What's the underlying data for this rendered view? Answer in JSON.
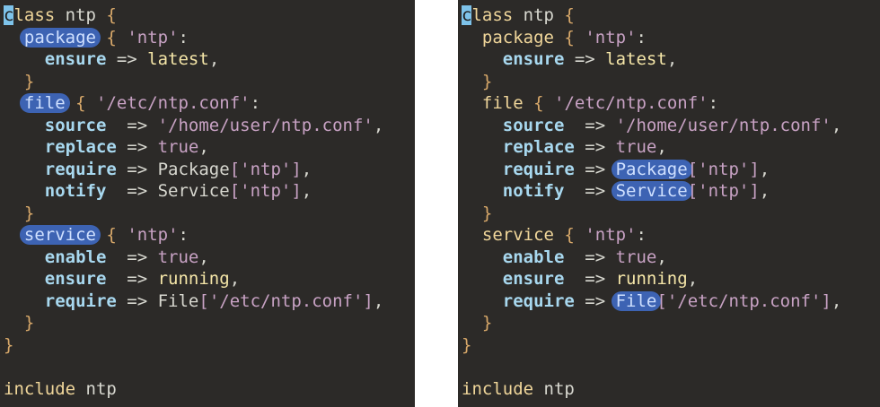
{
  "panes": [
    {
      "id": "left",
      "highlighted": [
        "package",
        "file",
        "service"
      ],
      "lines": [
        {
          "indent": "",
          "parts": [
            {
              "t": "c",
              "c": "kw cursor"
            },
            {
              "t": "lass ",
              "c": "kw"
            },
            {
              "t": "ntp ",
              "c": "plain"
            },
            {
              "t": "{",
              "c": "brace"
            }
          ]
        },
        {
          "indent": "  ",
          "parts": [
            {
              "t": "package",
              "c": "kw hl"
            },
            {
              "t": " ",
              "c": "plain"
            },
            {
              "t": "{",
              "c": "brace"
            },
            {
              "t": " 'ntp'",
              "c": "str"
            },
            {
              "t": ":",
              "c": "plain"
            }
          ]
        },
        {
          "indent": "    ",
          "parts": [
            {
              "t": "ensure",
              "c": "attr"
            },
            {
              "t": " => ",
              "c": "op"
            },
            {
              "t": "latest",
              "c": "val"
            },
            {
              "t": ",",
              "c": "plain"
            }
          ]
        },
        {
          "indent": "  ",
          "parts": [
            {
              "t": "}",
              "c": "brace"
            }
          ]
        },
        {
          "indent": "  ",
          "parts": [
            {
              "t": "file",
              "c": "kw hl"
            },
            {
              "t": " ",
              "c": "plain"
            },
            {
              "t": "{",
              "c": "brace"
            },
            {
              "t": " '/etc/ntp.conf'",
              "c": "str"
            },
            {
              "t": ":",
              "c": "plain"
            }
          ]
        },
        {
          "indent": "    ",
          "parts": [
            {
              "t": "source",
              "c": "attr"
            },
            {
              "t": "  => ",
              "c": "op"
            },
            {
              "t": "'/home/user/ntp.conf'",
              "c": "str"
            },
            {
              "t": ",",
              "c": "plain"
            }
          ]
        },
        {
          "indent": "    ",
          "parts": [
            {
              "t": "replace",
              "c": "attr"
            },
            {
              "t": " => ",
              "c": "op"
            },
            {
              "t": "true",
              "c": "str"
            },
            {
              "t": ",",
              "c": "plain"
            }
          ]
        },
        {
          "indent": "    ",
          "parts": [
            {
              "t": "require",
              "c": "attr"
            },
            {
              "t": " => ",
              "c": "op"
            },
            {
              "t": "Package",
              "c": "ref"
            },
            {
              "t": "['ntp']",
              "c": "str"
            },
            {
              "t": ",",
              "c": "plain"
            }
          ]
        },
        {
          "indent": "    ",
          "parts": [
            {
              "t": "notify",
              "c": "attr"
            },
            {
              "t": "  => ",
              "c": "op"
            },
            {
              "t": "Service",
              "c": "ref"
            },
            {
              "t": "['ntp']",
              "c": "str"
            },
            {
              "t": ",",
              "c": "plain"
            }
          ]
        },
        {
          "indent": "  ",
          "parts": [
            {
              "t": "}",
              "c": "brace"
            }
          ]
        },
        {
          "indent": "  ",
          "parts": [
            {
              "t": "service",
              "c": "kw hl"
            },
            {
              "t": " ",
              "c": "plain"
            },
            {
              "t": "{",
              "c": "brace"
            },
            {
              "t": " 'ntp'",
              "c": "str"
            },
            {
              "t": ":",
              "c": "plain"
            }
          ]
        },
        {
          "indent": "    ",
          "parts": [
            {
              "t": "enable",
              "c": "attr"
            },
            {
              "t": "  => ",
              "c": "op"
            },
            {
              "t": "true",
              "c": "str"
            },
            {
              "t": ",",
              "c": "plain"
            }
          ]
        },
        {
          "indent": "    ",
          "parts": [
            {
              "t": "ensure",
              "c": "attr"
            },
            {
              "t": "  => ",
              "c": "op"
            },
            {
              "t": "running",
              "c": "val"
            },
            {
              "t": ",",
              "c": "plain"
            }
          ]
        },
        {
          "indent": "    ",
          "parts": [
            {
              "t": "require",
              "c": "attr"
            },
            {
              "t": " => ",
              "c": "op"
            },
            {
              "t": "File",
              "c": "ref"
            },
            {
              "t": "['/etc/ntp.conf']",
              "c": "str"
            },
            {
              "t": ",",
              "c": "plain"
            }
          ]
        },
        {
          "indent": "  ",
          "parts": [
            {
              "t": "}",
              "c": "brace"
            }
          ]
        },
        {
          "indent": "",
          "parts": [
            {
              "t": "}",
              "c": "brace"
            }
          ]
        },
        {
          "indent": "",
          "parts": []
        },
        {
          "indent": "",
          "parts": [
            {
              "t": "include",
              "c": "kw"
            },
            {
              "t": " ntp",
              "c": "plain"
            }
          ]
        }
      ]
    },
    {
      "id": "right",
      "highlighted": [
        "Package",
        "Service",
        "File"
      ],
      "lines": [
        {
          "indent": "",
          "parts": [
            {
              "t": "c",
              "c": "kw cursor"
            },
            {
              "t": "lass ",
              "c": "kw"
            },
            {
              "t": "ntp ",
              "c": "plain"
            },
            {
              "t": "{",
              "c": "brace"
            }
          ]
        },
        {
          "indent": "  ",
          "parts": [
            {
              "t": "package",
              "c": "kw"
            },
            {
              "t": " ",
              "c": "plain"
            },
            {
              "t": "{",
              "c": "brace"
            },
            {
              "t": " 'ntp'",
              "c": "str"
            },
            {
              "t": ":",
              "c": "plain"
            }
          ]
        },
        {
          "indent": "    ",
          "parts": [
            {
              "t": "ensure",
              "c": "attr"
            },
            {
              "t": " => ",
              "c": "op"
            },
            {
              "t": "latest",
              "c": "val"
            },
            {
              "t": ",",
              "c": "plain"
            }
          ]
        },
        {
          "indent": "  ",
          "parts": [
            {
              "t": "}",
              "c": "brace"
            }
          ]
        },
        {
          "indent": "  ",
          "parts": [
            {
              "t": "file",
              "c": "kw"
            },
            {
              "t": " ",
              "c": "plain"
            },
            {
              "t": "{",
              "c": "brace"
            },
            {
              "t": " '/etc/ntp.conf'",
              "c": "str"
            },
            {
              "t": ":",
              "c": "plain"
            }
          ]
        },
        {
          "indent": "    ",
          "parts": [
            {
              "t": "source",
              "c": "attr"
            },
            {
              "t": "  => ",
              "c": "op"
            },
            {
              "t": "'/home/user/ntp.conf'",
              "c": "str"
            },
            {
              "t": ",",
              "c": "plain"
            }
          ]
        },
        {
          "indent": "    ",
          "parts": [
            {
              "t": "replace",
              "c": "attr"
            },
            {
              "t": " => ",
              "c": "op"
            },
            {
              "t": "true",
              "c": "str"
            },
            {
              "t": ",",
              "c": "plain"
            }
          ]
        },
        {
          "indent": "    ",
          "parts": [
            {
              "t": "require",
              "c": "attr"
            },
            {
              "t": " => ",
              "c": "op"
            },
            {
              "t": "Package",
              "c": "ref hl"
            },
            {
              "t": "['ntp']",
              "c": "str"
            },
            {
              "t": ",",
              "c": "plain"
            }
          ]
        },
        {
          "indent": "    ",
          "parts": [
            {
              "t": "notify",
              "c": "attr"
            },
            {
              "t": "  => ",
              "c": "op"
            },
            {
              "t": "Service",
              "c": "ref hl"
            },
            {
              "t": "['ntp']",
              "c": "str"
            },
            {
              "t": ",",
              "c": "plain"
            }
          ]
        },
        {
          "indent": "  ",
          "parts": [
            {
              "t": "}",
              "c": "brace"
            }
          ]
        },
        {
          "indent": "  ",
          "parts": [
            {
              "t": "service",
              "c": "kw"
            },
            {
              "t": " ",
              "c": "plain"
            },
            {
              "t": "{",
              "c": "brace"
            },
            {
              "t": " 'ntp'",
              "c": "str"
            },
            {
              "t": ":",
              "c": "plain"
            }
          ]
        },
        {
          "indent": "    ",
          "parts": [
            {
              "t": "enable",
              "c": "attr"
            },
            {
              "t": "  => ",
              "c": "op"
            },
            {
              "t": "true",
              "c": "str"
            },
            {
              "t": ",",
              "c": "plain"
            }
          ]
        },
        {
          "indent": "    ",
          "parts": [
            {
              "t": "ensure",
              "c": "attr"
            },
            {
              "t": "  => ",
              "c": "op"
            },
            {
              "t": "running",
              "c": "val"
            },
            {
              "t": ",",
              "c": "plain"
            }
          ]
        },
        {
          "indent": "    ",
          "parts": [
            {
              "t": "require",
              "c": "attr"
            },
            {
              "t": " => ",
              "c": "op"
            },
            {
              "t": "File",
              "c": "ref hl"
            },
            {
              "t": "['/etc/ntp.conf']",
              "c": "str"
            },
            {
              "t": ",",
              "c": "plain"
            }
          ]
        },
        {
          "indent": "  ",
          "parts": [
            {
              "t": "}",
              "c": "brace"
            }
          ]
        },
        {
          "indent": "",
          "parts": [
            {
              "t": "}",
              "c": "brace"
            }
          ]
        },
        {
          "indent": "",
          "parts": []
        },
        {
          "indent": "",
          "parts": [
            {
              "t": "include",
              "c": "kw"
            },
            {
              "t": " ntp",
              "c": "plain"
            }
          ]
        }
      ]
    }
  ],
  "colors": {
    "editor_bg": "#2c2a28",
    "highlight": "#3d63b3",
    "keyword": "#f0d69a",
    "attribute": "#a8d8ef",
    "string": "#c8a2c4",
    "value": "#f5e6a8"
  }
}
